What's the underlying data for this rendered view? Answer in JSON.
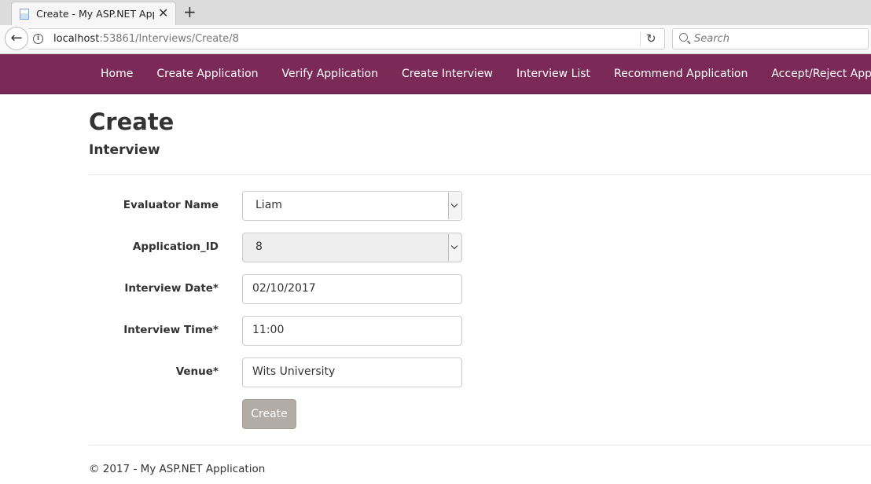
{
  "browser": {
    "tab_title": "Create - My ASP.NET Applic",
    "url_host": "localhost",
    "url_rest": ":53861/Interviews/Create/8",
    "search_placeholder": "Search"
  },
  "nav": {
    "items": [
      {
        "label": "Home"
      },
      {
        "label": "Create Application"
      },
      {
        "label": "Verify Application"
      },
      {
        "label": "Create Interview"
      },
      {
        "label": "Interview List"
      },
      {
        "label": "Recommend Application"
      },
      {
        "label": "Accept/Reject Application"
      }
    ]
  },
  "page": {
    "title": "Create",
    "subtitle": "Interview"
  },
  "form": {
    "evaluator_label": "Evaluator Name",
    "evaluator_value": "Liam",
    "application_label": "Application_ID",
    "application_value": "8",
    "date_label": "Interview Date*",
    "date_value": "02/10/2017",
    "time_label": "Interview Time*",
    "time_value": "11:00",
    "venue_label": "Venue*",
    "venue_value": "Wits University",
    "submit_label": "Create"
  },
  "footer": {
    "text": "© 2017 - My ASP.NET Application"
  },
  "colors": {
    "nav_bg": "#7b2a58",
    "button_bg": "#b1aca5"
  }
}
